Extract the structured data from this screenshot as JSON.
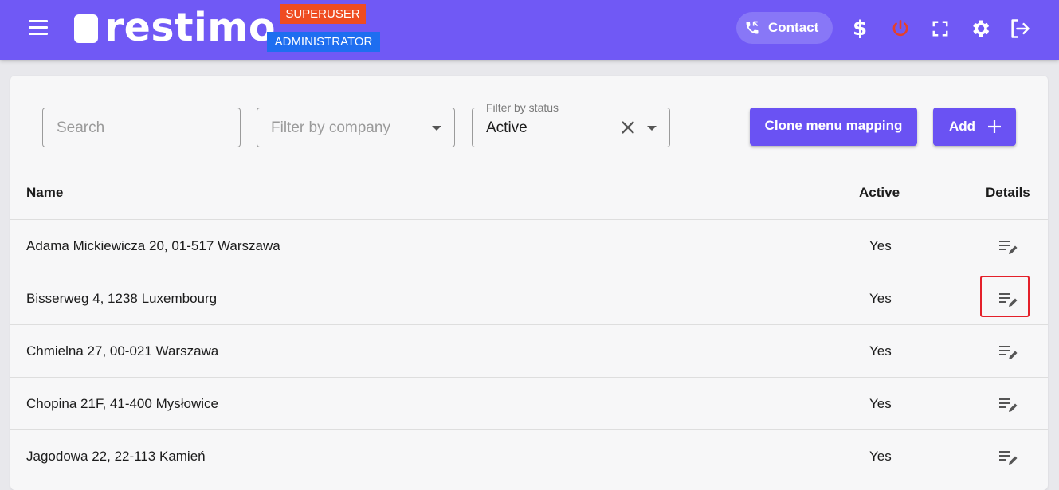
{
  "header": {
    "logo_text": "restimo",
    "badge_superuser": "SUPERUSER",
    "badge_administrator": "ADMINISTRATOR",
    "contact_label": "Contact",
    "dollar_symbol": "$",
    "icons": [
      "menu-icon",
      "phone-icon",
      "dollar-icon",
      "power-icon",
      "fullscreen-icon",
      "gear-icon",
      "logout-icon"
    ],
    "colors": {
      "bar": "#7059f5",
      "superuser": "#ef4c21",
      "administrator": "#1e6ef0",
      "power": "#e5402a"
    }
  },
  "filters": {
    "search_placeholder": "Search",
    "company_placeholder": "Filter by company",
    "status_label": "Filter by status",
    "status_value": "Active"
  },
  "actions": {
    "clone_label": "Clone menu mapping",
    "add_label": "Add"
  },
  "table": {
    "columns": {
      "name": "Name",
      "active": "Active",
      "details": "Details"
    },
    "rows": [
      {
        "name": "Adama Mickiewicza 20, 01-517 Warszawa",
        "active": "Yes"
      },
      {
        "name": "Bisserweg 4, 1238 Luxembourg",
        "active": "Yes"
      },
      {
        "name": "Chmielna 27, 00-021 Warszawa",
        "active": "Yes"
      },
      {
        "name": "Chopina 21F, 41-400 Mysłowice",
        "active": "Yes"
      },
      {
        "name": "Jagodowa 22, 22-113 Kamień",
        "active": "Yes"
      }
    ]
  }
}
